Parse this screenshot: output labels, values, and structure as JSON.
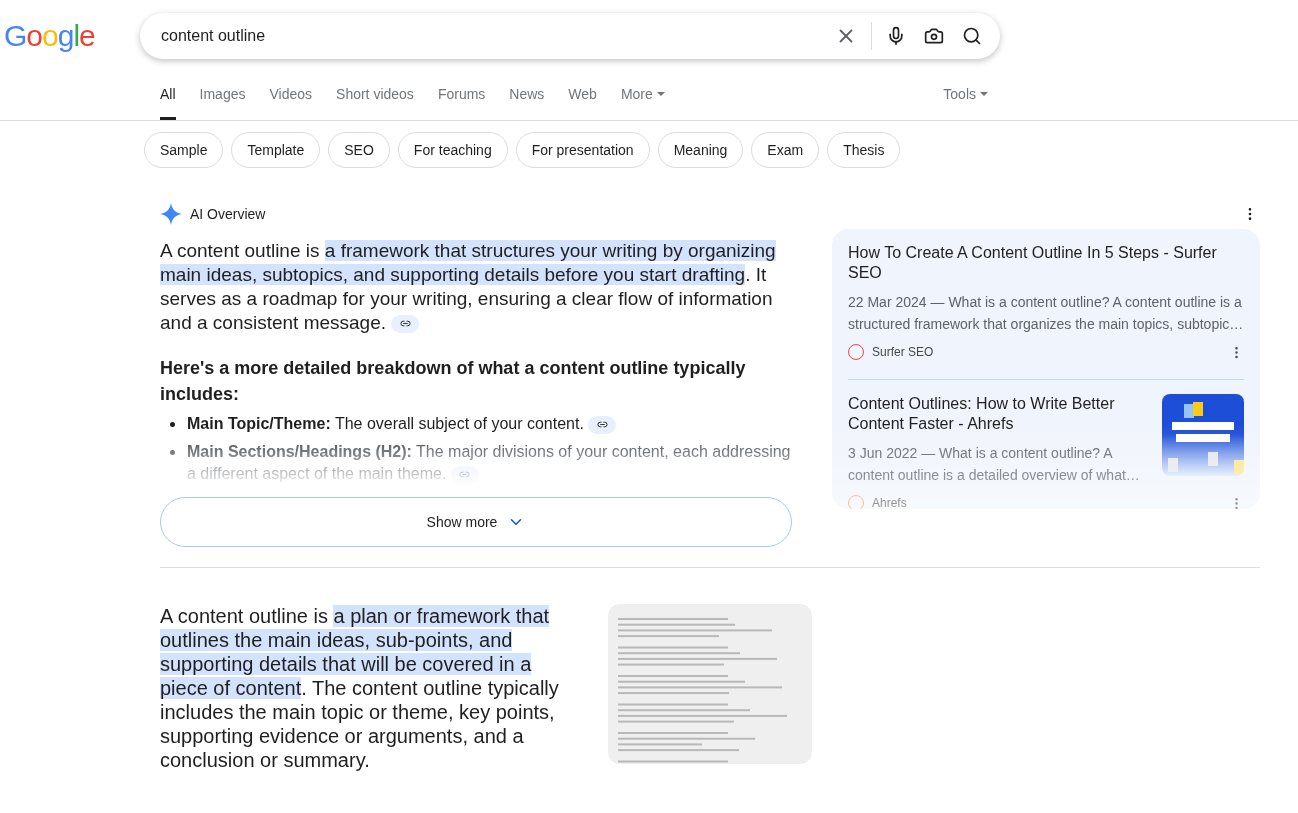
{
  "logo": "Google",
  "search": {
    "value": "content outline"
  },
  "tabs": [
    {
      "label": "All",
      "selected": true,
      "kind": "tab"
    },
    {
      "label": "Images",
      "selected": false,
      "kind": "tab"
    },
    {
      "label": "Videos",
      "selected": false,
      "kind": "tab"
    },
    {
      "label": "Short videos",
      "selected": false,
      "kind": "tab"
    },
    {
      "label": "Forums",
      "selected": false,
      "kind": "tab"
    },
    {
      "label": "News",
      "selected": false,
      "kind": "tab"
    },
    {
      "label": "Web",
      "selected": false,
      "kind": "tab"
    },
    {
      "label": "More",
      "selected": false,
      "kind": "menu"
    }
  ],
  "tools": "Tools",
  "chips": [
    "Sample",
    "Template",
    "SEO",
    "For teaching",
    "For presentation",
    "Meaning",
    "Exam",
    "Thesis"
  ],
  "ai_overview": {
    "title": "AI Overview",
    "paragraph": "A content outline is **a framework that structures your writing by organizing main ideas, subtopics, and supporting details before you start drafting**. It serves as a roadmap for your writing, ensuring a clear flow of information and a consistent message.",
    "heading": "Here's a more detailed breakdown of what a content outline typically includes:",
    "bullets": [
      {
        "term": "Main Topic/Theme:",
        "text": "The overall subject of your content."
      },
      {
        "term": "Main Sections/Headings (H2):",
        "text": "The major divisions of your content, each addressing a different aspect of the main theme."
      }
    ],
    "show_more": "Show more",
    "sources": [
      {
        "title": "How To Create A Content Outline In 5 Steps - Surfer SEO",
        "snippet": "22 Mar 2024 — What is a content outline? A content outline is a structured framework that organizes the main topics, subtopic…",
        "source": "Surfer SEO"
      },
      {
        "title": "Content Outlines: How to Write Better Content Faster - Ahrefs",
        "snippet": "3 Jun 2022 — What is a content outline? A content outline is a detailed overview of what…",
        "source": "Ahrefs"
      }
    ]
  },
  "result": {
    "paragraph": "A content outline is **a plan or framework that outlines the main ideas, sub-points, and supporting details that will be covered in a piece of content**. The content outline typically includes the main topic or theme, key points, supporting evidence or arguments, and a conclusion or summary."
  }
}
